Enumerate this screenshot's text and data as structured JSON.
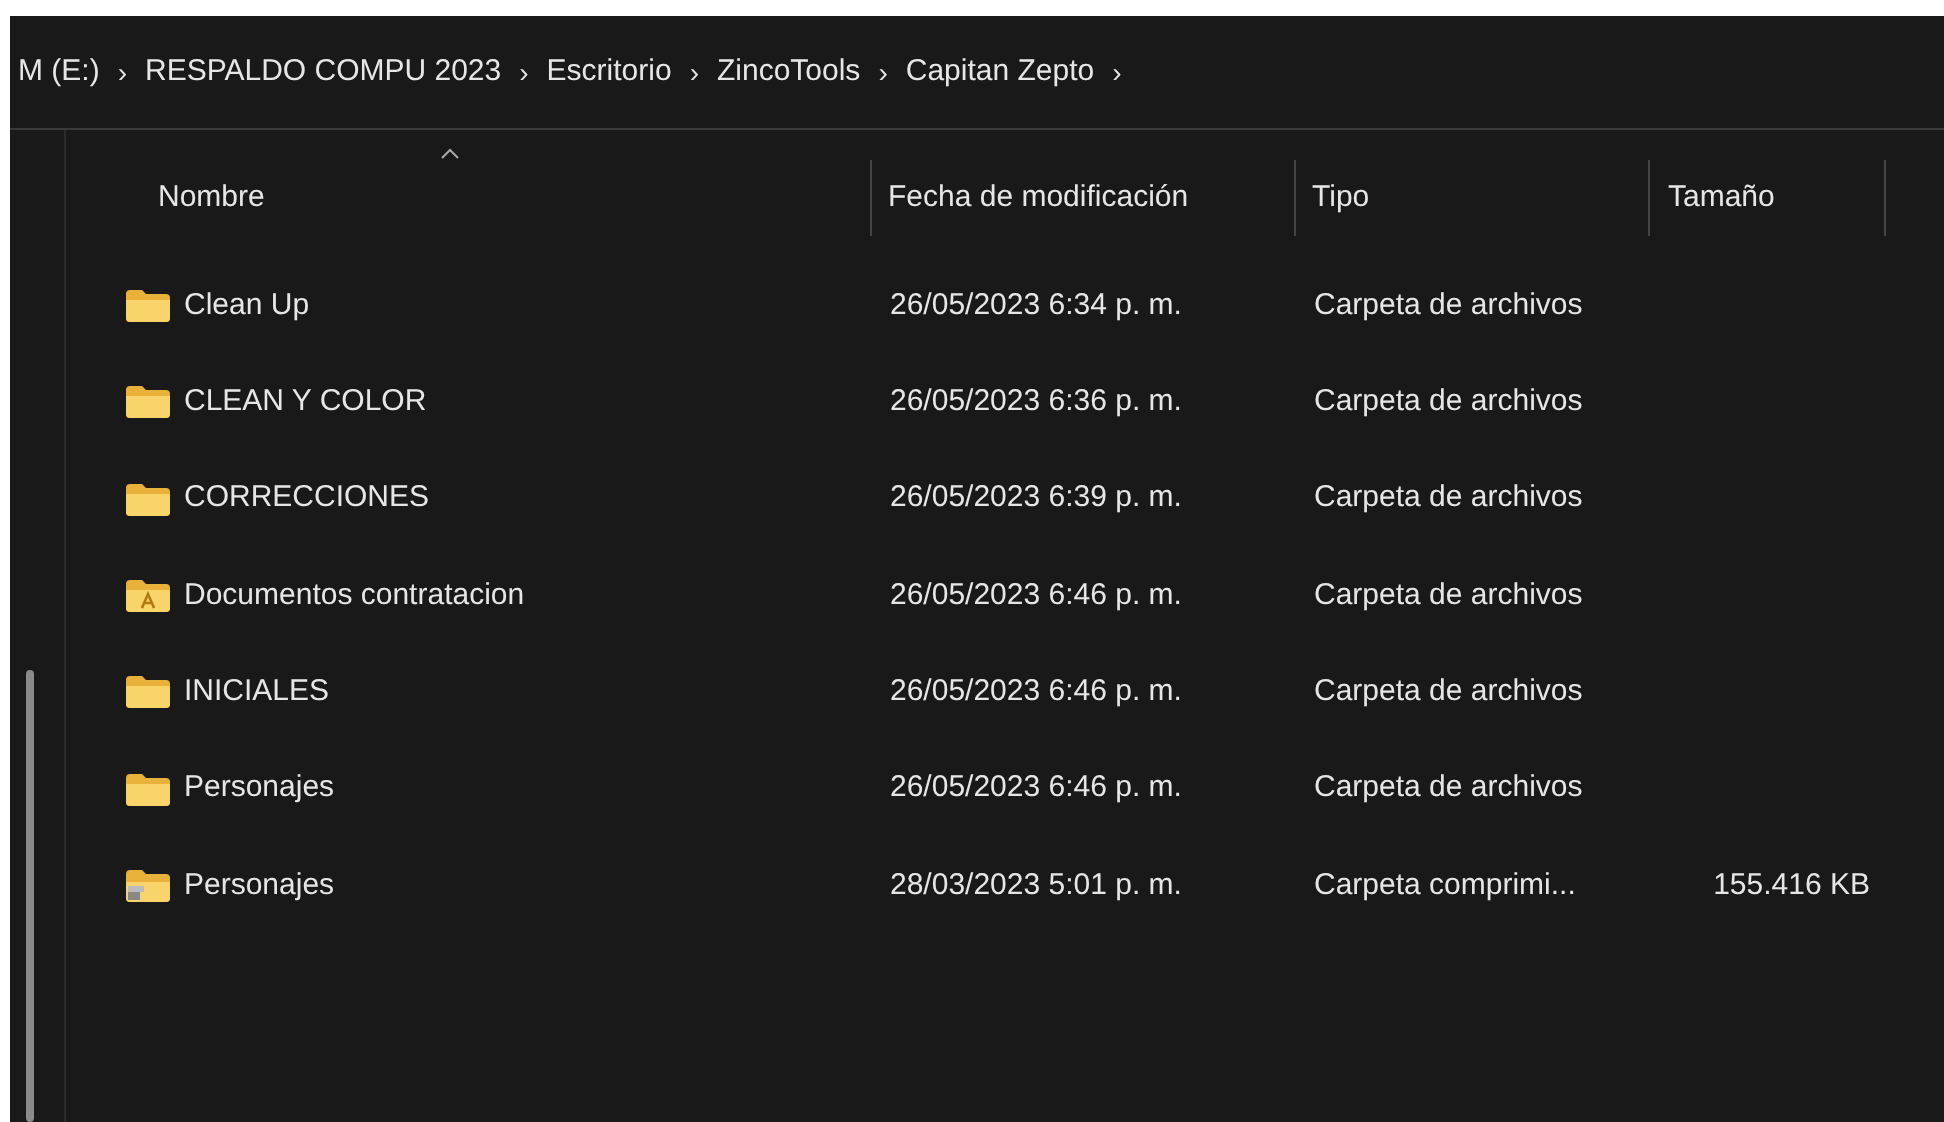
{
  "breadcrumb": [
    "M (E:)",
    "RESPALDO COMPU 2023",
    "Escritorio",
    "ZincoTools",
    "Capitan Zepto"
  ],
  "breadcrumb_separator": "›",
  "table": {
    "columns": [
      "Nombre",
      "Fecha de modificación",
      "Tipo",
      "Tamaño"
    ],
    "rows": [
      {
        "kind": "folder",
        "name": "Clean Up",
        "date": "26/05/2023 6:34 p. m.",
        "type": "Carpeta de archivos"
      },
      {
        "kind": "folder",
        "name": "CLEAN Y COLOR",
        "date": "26/05/2023 6:36 p. m.",
        "type": "Carpeta de archivos"
      },
      {
        "kind": "folder",
        "name": "CORRECCIONES",
        "date": "26/05/2023 6:39 p. m.",
        "type": "Carpeta de archivos"
      },
      {
        "kind": "document-folder",
        "name": "Documentos contratacion",
        "date": "26/05/2023 6:46 p. m.",
        "type": "Carpeta de archivos"
      },
      {
        "kind": "folder",
        "name": "INICIALES",
        "date": "26/05/2023 6:46 p. m.",
        "type": "Carpeta de archivos"
      },
      {
        "kind": "folder",
        "name": "Personajes",
        "date": "26/05/2023 6:46 p. m.",
        "type": "Carpeta de archivos"
      },
      {
        "kind": "zip",
        "name": "Personajes",
        "date": "28/03/2023 5:01 p. m.",
        "type": "Carpeta comprimi...",
        "size": "155.416 KB"
      }
    ]
  }
}
